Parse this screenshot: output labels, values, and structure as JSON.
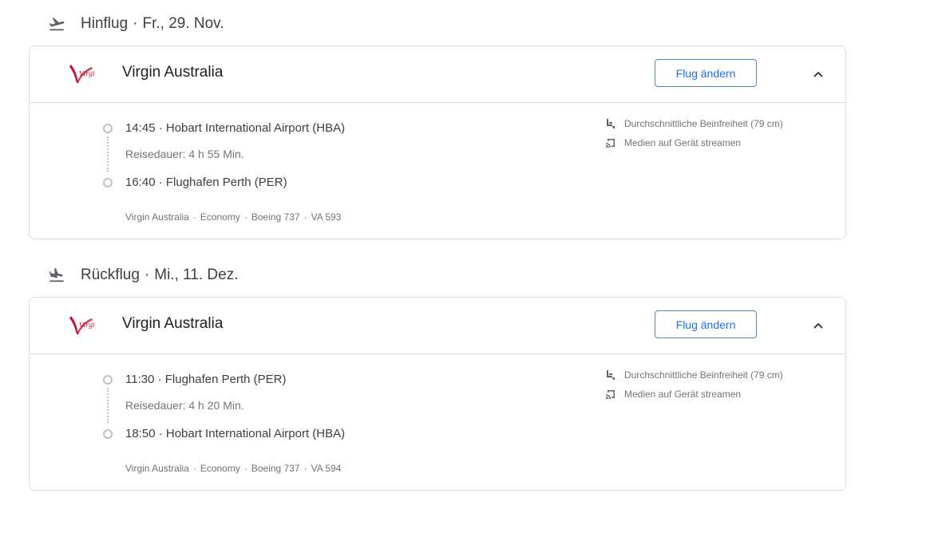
{
  "outbound": {
    "label": "Hinflug",
    "date": "Fr., 29. Nov.",
    "airline": "Virgin Australia",
    "change_button": "Flug ändern",
    "departure": "14:45 · Hobart International Airport (HBA)",
    "duration": "Reisedauer: 4 h 55 Min.",
    "arrival": "16:40 · Flughafen Perth (PER)",
    "details": [
      "Virgin Australia",
      "Economy",
      "Boeing 737",
      "VA 593"
    ],
    "amenities": [
      "Durchschnittliche Beinfreiheit (79 cm)",
      "Medien auf Gerät streamen"
    ]
  },
  "return": {
    "label": "Rückflug",
    "date": "Mi., 11. Dez.",
    "airline": "Virgin Australia",
    "change_button": "Flug ändern",
    "departure": "11:30 · Flughafen Perth (PER)",
    "duration": "Reisedauer: 4 h 20 Min.",
    "arrival": "18:50 · Hobart International Airport (HBA)",
    "details": [
      "Virgin Australia",
      "Economy",
      "Boeing 737",
      "VA 594"
    ],
    "amenities": [
      "Durchschnittliche Beinfreiheit (79 cm)",
      "Medien auf Gerät streamen"
    ]
  },
  "icons": {
    "takeoff": "flight-takeoff-icon",
    "landing": "flight-land-icon",
    "airline_logo": "virgin-australia-logo",
    "collapse": "chevron-up-icon",
    "legroom": "seat-legroom-icon",
    "stream": "cast-stream-icon"
  },
  "colors": {
    "accent": "#1a73e8",
    "border": "#dadce0",
    "text": "#3c4043",
    "muted": "#70757a",
    "logo_red": "#c8102e"
  }
}
